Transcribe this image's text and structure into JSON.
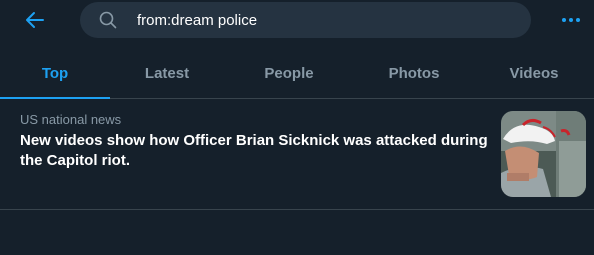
{
  "header": {
    "back_icon": "arrow-left-icon",
    "search_icon": "search-icon",
    "search_value": "from:dream police",
    "more_icon": "more-horizontal-icon"
  },
  "tabs": [
    {
      "label": "Top",
      "active": true
    },
    {
      "label": "Latest",
      "active": false
    },
    {
      "label": "People",
      "active": false
    },
    {
      "label": "Photos",
      "active": false
    },
    {
      "label": "Videos",
      "active": false
    }
  ],
  "news": {
    "category": "US national news",
    "headline": "New videos show how Officer Brian Sicknick was attacked during the Capitol riot."
  },
  "colors": {
    "background": "#15202b",
    "accent": "#1da1f2",
    "search_bg": "#253341",
    "muted_text": "#8899a6",
    "divider": "#38444d"
  }
}
